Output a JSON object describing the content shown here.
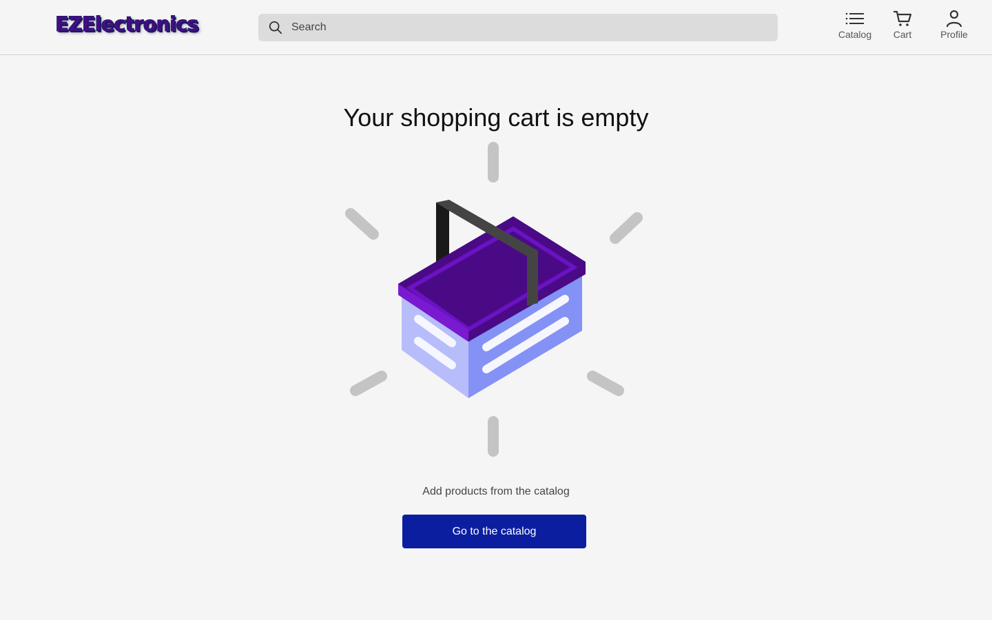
{
  "header": {
    "logo_text": "EZElectronics",
    "search": {
      "placeholder": "Search",
      "value": ""
    },
    "nav": {
      "catalog_label": "Catalog",
      "cart_label": "Cart",
      "profile_label": "Profile"
    }
  },
  "main": {
    "title": "Your shopping cart is empty",
    "subtitle": "Add products from the catalog",
    "cta_label": "Go to the catalog",
    "illustration_icon": "shopping-basket-icon"
  },
  "colors": {
    "brand_primary": "#0c1ea0",
    "logo_purple": "#4a0a86",
    "basket_rim": "#6a12c4",
    "basket_body": "#b7bdfb",
    "background": "#f5f5f5"
  }
}
